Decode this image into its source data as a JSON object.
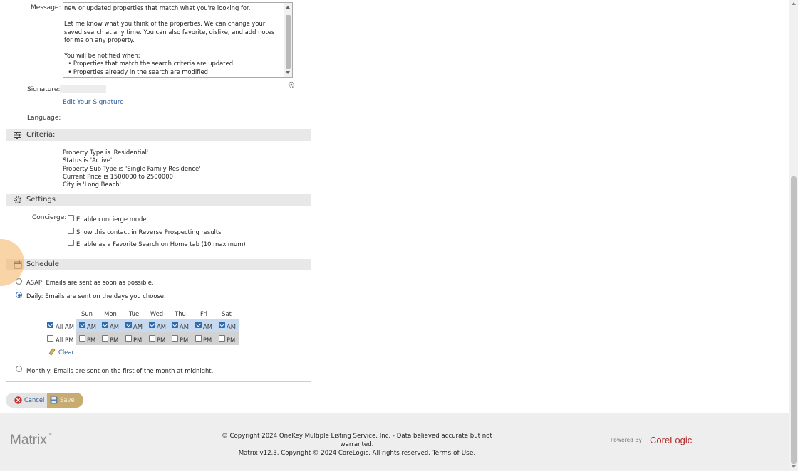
{
  "form": {
    "message_label": "Message:",
    "message_text": "new or updated properties that match what you're looking for.\n\nLet me know what you think of the properties. We can change your saved search at any time. You can also favorite, dislike, and add notes for me on any property.\n\nYou will be notified when:\n  • Properties that match the search criteria are updated\n  • Properties already in the search are modified",
    "signature_label": "Signature:",
    "edit_signature_link": "Edit Your Signature",
    "language_label": "Language:"
  },
  "criteria": {
    "title": "Criteria:",
    "lines": [
      "Property Type is 'Residential'",
      "Status is 'Active'",
      "Property Sub Type is 'Single Family Residence'",
      "Current Price is 1500000 to 2500000",
      "City is 'Long Beach'"
    ]
  },
  "settings": {
    "title": "Settings",
    "concierge_label": "Concierge:",
    "options": [
      {
        "label": "Enable concierge mode",
        "checked": false
      },
      {
        "label": "Show this contact in Reverse Prospecting results",
        "checked": false
      },
      {
        "label": "Enable as a Favorite Search on Home tab (10 maximum)",
        "checked": false
      }
    ]
  },
  "schedule": {
    "title": "Schedule",
    "asap": "ASAP: Emails are sent as soon as possible.",
    "daily": "Daily: Emails are sent on the days you choose.",
    "monthly": "Monthly: Emails are sent on the first of the month at midnight.",
    "selected": "daily",
    "days": [
      "Sun",
      "Mon",
      "Tue",
      "Wed",
      "Thu",
      "Fri",
      "Sat"
    ],
    "all_am": "All AM",
    "all_pm": "All PM",
    "am": "AM",
    "pm": "PM",
    "am_checked": true,
    "pm_checked": false,
    "clear": "Clear"
  },
  "buttons": {
    "cancel": "Cancel",
    "save": "Save"
  },
  "footer": {
    "logo": "Matrix",
    "copyright1": "© Copyright 2024 OneKey Multiple Listing Service, Inc. - Data believed accurate but not warranted.",
    "copyright2": "Matrix v12.3. Copyright © 2024 CoreLogic. All rights reserved.",
    "terms": "Terms of Use.",
    "powered_by": "Powered By",
    "brand": "CoreLogic"
  },
  "colors": {
    "accent": "#2b6cb0",
    "save_button": "#c8ab6e",
    "link": "#2a5a9a",
    "highlight": "#f4b05c"
  }
}
